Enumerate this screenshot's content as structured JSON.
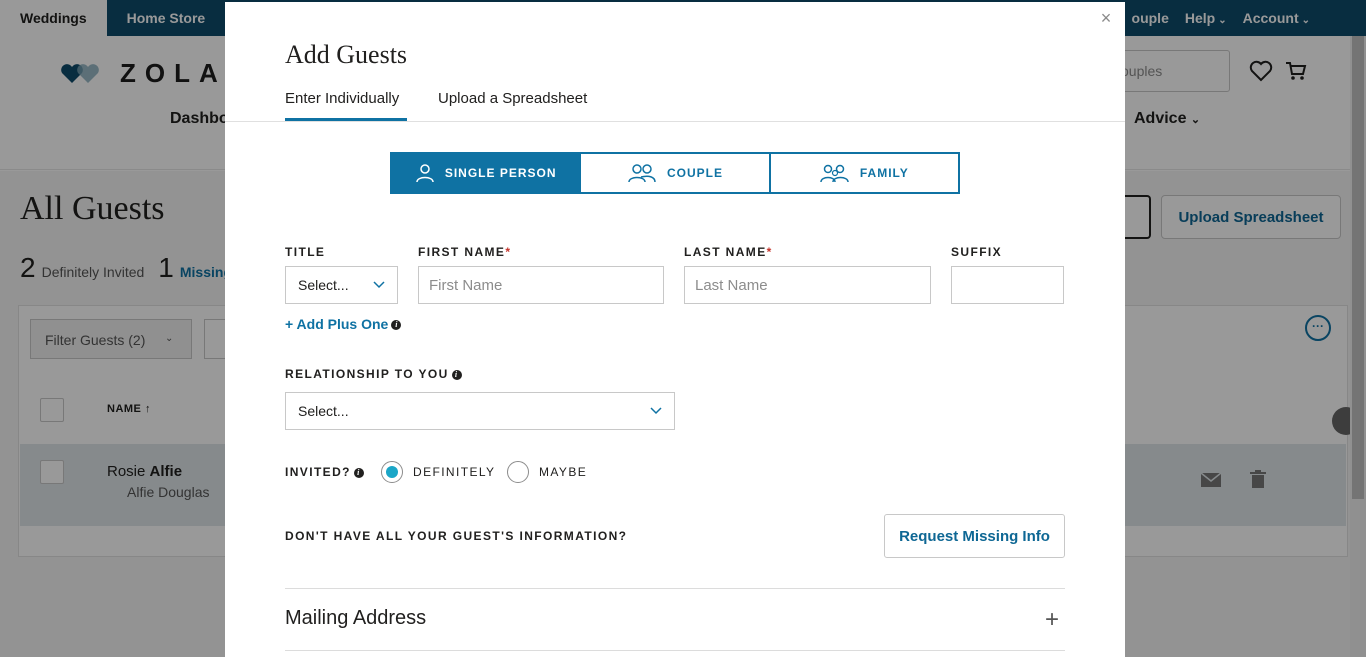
{
  "topbar": {
    "tabs": [
      "Weddings",
      "Home Store"
    ],
    "right": {
      "couple": "ouple",
      "help": "Help",
      "account": "Account"
    }
  },
  "header": {
    "logo_text": "ZOLA",
    "search_placeholder": "ouples",
    "nav_left": "Dashbo",
    "nav_right": "Advice"
  },
  "page": {
    "title": "All Guests",
    "stats": {
      "invited_count": "2",
      "invited_label": "Definitely Invited",
      "missing_count": "1",
      "missing_label": "Missing"
    },
    "upload_button": "Upload Spreadsheet",
    "filter_label": "Filter Guests (2)",
    "column_name": "NAME",
    "row": {
      "first": "Rosie",
      "last": "Alfie",
      "sub": "Alfie Douglas"
    }
  },
  "modal": {
    "title": "Add Guests",
    "tabs": {
      "active": "Enter Individually",
      "inactive": "Upload a Spreadsheet"
    },
    "segments": {
      "single": "SINGLE PERSON",
      "couple": "COUPLE",
      "family": "FAMILY"
    },
    "fields": {
      "title_label": "TITLE",
      "title_value": "Select...",
      "first_label": "FIRST NAME",
      "first_placeholder": "First Name",
      "last_label": "LAST NAME",
      "last_placeholder": "Last Name",
      "suffix_label": "SUFFIX",
      "required_mark": "*"
    },
    "plus_one": "+ Add Plus One",
    "relationship_label": "RELATIONSHIP TO YOU",
    "relationship_value": "Select...",
    "invited_label": "INVITED?",
    "invited_options": {
      "definitely": "DEFINITELY",
      "maybe": "MAYBE"
    },
    "missing_info_question": "DON'T HAVE ALL YOUR GUEST'S INFORMATION?",
    "request_button": "Request Missing Info",
    "mailing_title": "Mailing Address",
    "close_glyph": "×",
    "accent_color": "#0f72a3"
  }
}
